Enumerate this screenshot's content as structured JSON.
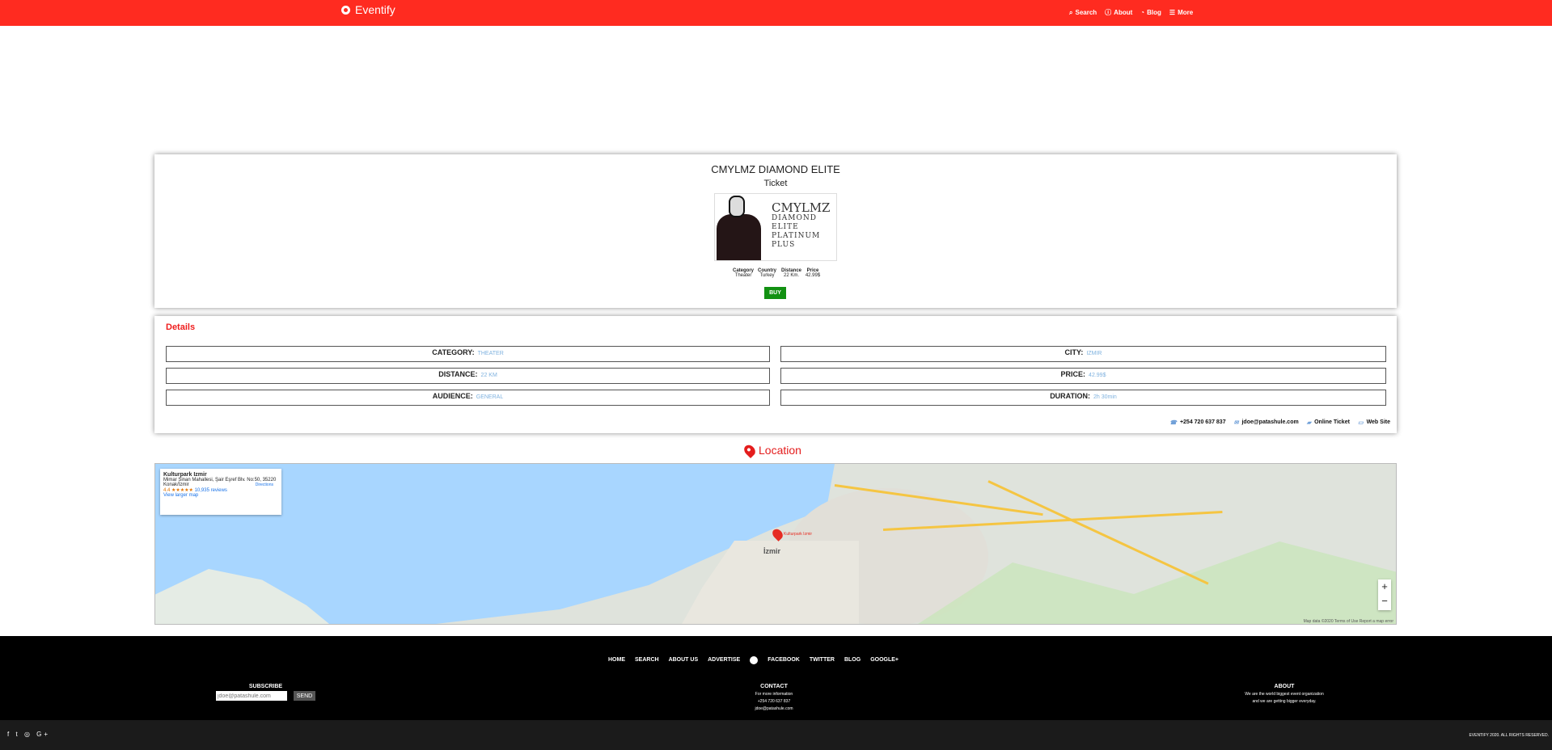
{
  "brand": {
    "name": "Eventify"
  },
  "nav": {
    "items": [
      {
        "icon": "search-icon",
        "label": "Search"
      },
      {
        "icon": "info-icon",
        "label": "About"
      },
      {
        "icon": "wifi-icon",
        "label": "Blog"
      },
      {
        "icon": "menu-icon",
        "label": "More"
      }
    ]
  },
  "event": {
    "title": "CMYLMZ DIAMOND ELITE",
    "subtitle": "Ticket",
    "poster": {
      "title": "CMYLMZ",
      "lines": [
        "DIAMOND",
        "ELITE",
        "PLATINUM",
        "PLUS"
      ]
    },
    "summary": {
      "headers": [
        "Category",
        "Country",
        "Distance",
        "Price"
      ],
      "values": [
        "Theater",
        "Turkey",
        "22 Km.",
        "42.99$"
      ]
    },
    "buy": "BUY"
  },
  "details": {
    "title": "Details",
    "fields": [
      {
        "label": "CATEGORY:",
        "value": "THEATER"
      },
      {
        "label": "CITY:",
        "value": "IZMIR"
      },
      {
        "label": "DISTANCE:",
        "value": "22 KM"
      },
      {
        "label": "PRICE:",
        "value": "42.99$"
      },
      {
        "label": "AUDIENCE:",
        "value": "GENERAL"
      },
      {
        "label": "DURATION:",
        "value": "2h 30min"
      }
    ],
    "contacts": [
      "+254 720 637 837",
      "jdoe@patashule.com",
      "Online Ticket",
      "Web Site"
    ]
  },
  "location": {
    "title": "Location",
    "place": "Kulturpark Izmir",
    "address": "Mimar Sinan Mahallesi, Şair Eşref Blv. No:50, 35220 Konak/İzmir",
    "rating": "4.4 ★★★★★",
    "reviews": "10,935 reviews",
    "directions": "Directions",
    "larger": "View larger map",
    "marker": "Kulturpark Izmir",
    "city": "İzmir",
    "footer": "Map data ©2020   Terms of Use   Report a map error"
  },
  "footer": {
    "nav": [
      "HOME",
      "SEARCH",
      "ABOUT US",
      "ADVERTISE",
      "FACEBOOK",
      "TWITTER",
      "BLOG",
      "GOOGLE+"
    ],
    "subscribe": {
      "title": "SUBSCRIBE",
      "placeholder": "jdoe@patashule.com",
      "button": "SEND"
    },
    "contact": {
      "title": "CONTACT",
      "line1": "For more information",
      "phone": "+254 720 637 837",
      "email": "jdoe@patashule.com"
    },
    "about": {
      "title": "ABOUT",
      "line1": "We are the world biggest event organization",
      "line2": "and we are getting bigger everyday."
    },
    "copyright": "EVENTIFY 2020. ALL RIGHTS RESERVED."
  }
}
